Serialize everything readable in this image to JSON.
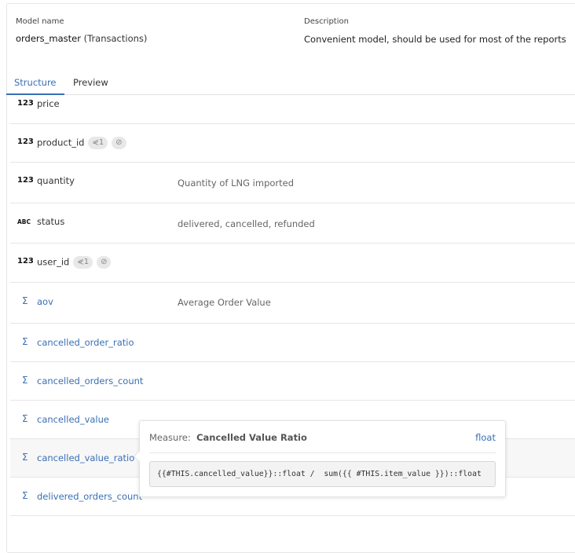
{
  "header": {
    "model_name_label": "Model name",
    "model_name": "orders_master",
    "model_alias": "(Transactions)",
    "description_label": "Description",
    "description": "Convenient model, should be used for most of the reports"
  },
  "tabs": [
    {
      "label": "Structure",
      "active": true
    },
    {
      "label": "Preview",
      "active": false
    }
  ],
  "fields": [
    {
      "type": "123",
      "name": "price",
      "description": ""
    },
    {
      "type": "123",
      "name": "product_id",
      "description": "",
      "links": "1",
      "hidden": true
    },
    {
      "type": "123",
      "name": "quantity",
      "description": "Quantity of LNG imported"
    },
    {
      "type": "ABC",
      "name": "status",
      "description": "delivered, cancelled, refunded"
    },
    {
      "type": "123",
      "name": "user_id",
      "description": "",
      "links": "1",
      "hidden": true
    },
    {
      "type": "Σ",
      "name": "aov",
      "description": "Average Order Value"
    },
    {
      "type": "Σ",
      "name": "cancelled_order_ratio",
      "description": ""
    },
    {
      "type": "Σ",
      "name": "cancelled_orders_count",
      "description": ""
    },
    {
      "type": "Σ",
      "name": "cancelled_value",
      "description": ""
    },
    {
      "type": "Σ",
      "name": "cancelled_value_ratio",
      "description": ""
    },
    {
      "type": "Σ",
      "name": "delivered_orders_count",
      "description": ""
    }
  ],
  "tooltip": {
    "prefix": "Measure:",
    "title": "Cancelled Value Ratio",
    "type": "float",
    "sql": "{{#THIS.cancelled_value}}::float /  sum({{ #THIS.item_value }})::float"
  },
  "colors": {
    "accent": "#3a6fb4"
  }
}
